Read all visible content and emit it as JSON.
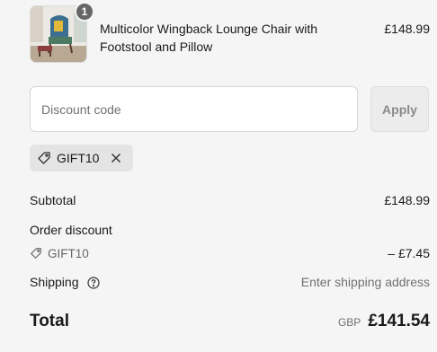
{
  "product": {
    "quantity": "1",
    "name": "Multicolor Wingback Lounge Chair with Footstool and Pillow",
    "price": "£148.99"
  },
  "discount": {
    "placeholder": "Discount code",
    "apply_label": "Apply",
    "applied_code": "GIFT10"
  },
  "summary": {
    "subtotal_label": "Subtotal",
    "subtotal_value": "£148.99",
    "order_discount_label": "Order discount",
    "discount_code": "GIFT10",
    "discount_value": "– £7.45",
    "shipping_label": "Shipping",
    "shipping_value": "Enter shipping address",
    "total_label": "Total",
    "currency": "GBP",
    "total_value": "£141.54"
  },
  "icons": {
    "tag": "tag-icon",
    "remove": "close-icon",
    "help": "question-circle-icon"
  }
}
